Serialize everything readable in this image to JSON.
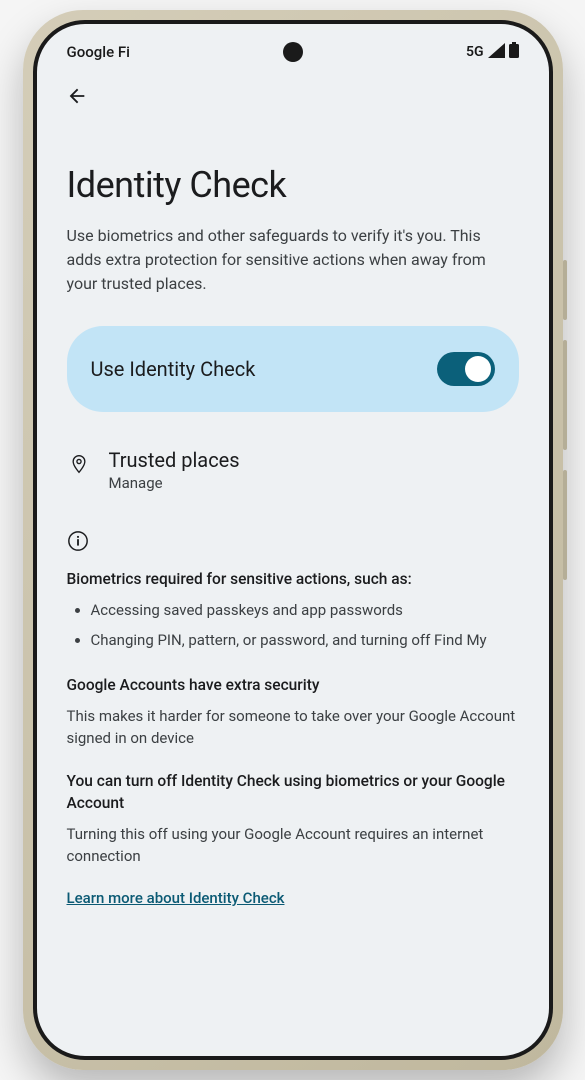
{
  "status": {
    "carrier": "Google Fi",
    "network": "5G"
  },
  "page": {
    "title": "Identity Check",
    "subtitle": "Use biometrics and other safeguards to verify it's you. This adds extra protection for sensitive actions when away from your trusted places."
  },
  "toggle": {
    "label": "Use Identity Check",
    "enabled": true
  },
  "trusted": {
    "title": "Trusted places",
    "action": "Manage"
  },
  "details": {
    "heading1": "Biometrics required for sensitive actions, such as:",
    "bullets": [
      "Accessing saved passkeys and app passwords",
      "Changing PIN, pattern, or password, and turning off Find My"
    ],
    "heading2": "Google Accounts have extra security",
    "para2": "This makes it harder for someone to take over your Google Account signed in on device",
    "heading3": "You can turn off Identity Check using biometrics or your Google Account",
    "para3": "Turning this off using your Google Account requires an internet connection",
    "link": "Learn more about Identity Check"
  }
}
